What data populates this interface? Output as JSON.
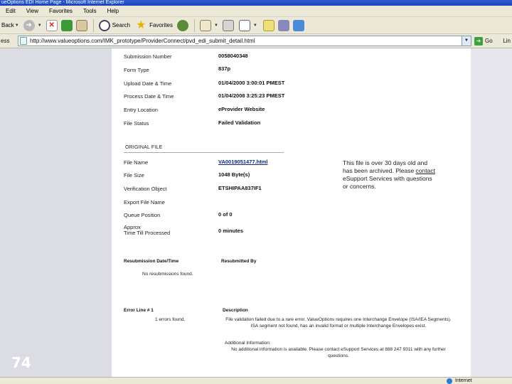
{
  "window": {
    "title": "ueOptions EDI Home Page - Microsoft Internet Explorer"
  },
  "menu": {
    "items": [
      "Edit",
      "View",
      "Favorites",
      "Tools",
      "Help"
    ]
  },
  "toolbar": {
    "back_label": "Back",
    "search_label": "Search",
    "favorites_label": "Favorites"
  },
  "address": {
    "label": "ess",
    "url": "http://www.valueoptions.com/IMK_prototype/ProviderConnect/pvd_edi_submit_detail.html",
    "go_label": "Go",
    "links_label": "Lin"
  },
  "slide": {
    "number": "74"
  },
  "submission": {
    "fields": [
      {
        "label": "Submission Number",
        "value": "0058040348"
      },
      {
        "label": "Form Type",
        "value": "837p"
      },
      {
        "label": "Upload Date & Time",
        "value": "01/04/2000 3:00:01 PMEST"
      },
      {
        "label": "Process Date & Time",
        "value": "01/04/2008 3:25:23 PMEST"
      },
      {
        "label": "Entry Location",
        "value": "eProvider Website"
      },
      {
        "label": "File Status",
        "value": "Failed Validation"
      }
    ]
  },
  "original_file": {
    "heading": "ORIGINAL FILE",
    "fields": [
      {
        "label": "File Name",
        "value": "VA0019051477.html"
      },
      {
        "label": "File Size",
        "value": "1048 Byte(s)"
      },
      {
        "label": "Verification Object",
        "value": "ETSHIPAA837IF1"
      },
      {
        "label": "Export File Name",
        "value": ""
      },
      {
        "label": "Queue Position",
        "value": "0 of 0"
      },
      {
        "label": "Approx\nTime Till Processed",
        "value": "0 minutes"
      }
    ]
  },
  "archive_note": {
    "before": "This file is over 30 days old and has been archived. Please ",
    "link": "contact",
    "after": " eSupport Services with questions or concerns."
  },
  "resubmission": {
    "col1_header": "Resubmission Date/Time",
    "col2_header": "Resubmitted By",
    "empty_text": "No resubmissions found."
  },
  "errors": {
    "col1_header": "Error Line # 1",
    "col2_header": "Description",
    "found_text": "1 errors found.",
    "description": "File validation failed due to a rare error. ValueOptions requires one Interchange Envelope (ISA/IEA Segments). ISA segment not found, has an invalid format or multiple Interchange Envelopes exist.",
    "additional_header": "Additional Information:",
    "additional_text": "No additional information is available. Please contact eSupport Services at 888 247 9311 with any further questions."
  },
  "status": {
    "zone": "Internet"
  }
}
